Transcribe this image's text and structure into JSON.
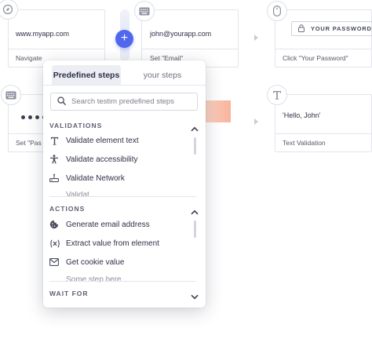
{
  "steps": {
    "row1": [
      {
        "value": "www.myapp.com",
        "label": "Navigate",
        "icon": "compass-icon"
      },
      {
        "value": "john@yourapp.com",
        "label": "Set \"Email\"",
        "icon": "keyboard-icon"
      },
      {
        "value": "YOUR PASSWORD",
        "label": "Click \"Your Password\"",
        "icon": "mouse-icon"
      }
    ],
    "row2": [
      {
        "label": "Set \"Pas",
        "icon": "keyboard-icon"
      },
      {
        "value": "'Hello, John'",
        "label": "Text Validation",
        "icon": "text-icon"
      }
    ]
  },
  "add_button": "+",
  "popup": {
    "tabs": [
      {
        "label": "Predefined steps",
        "active": true
      },
      {
        "label": "your steps",
        "active": false
      }
    ],
    "search_placeholder": "Search testim predefined steps",
    "sections": [
      {
        "title": "VALIDATIONS",
        "expanded": true,
        "items": [
          {
            "label": "Validate element text",
            "icon": "text-icon"
          },
          {
            "label": "Validate accessibility",
            "icon": "accessibility-icon"
          },
          {
            "label": "Validate Network",
            "icon": "network-icon"
          },
          {
            "label": "Validat...",
            "icon": "",
            "partial": true
          }
        ]
      },
      {
        "title": "ACTIONS",
        "expanded": true,
        "items": [
          {
            "label": "Generate email address",
            "icon": "cookie-icon"
          },
          {
            "label": "Extract value from element",
            "icon": "variable-icon"
          },
          {
            "label": "Get cookie value",
            "icon": "envelope-icon"
          },
          {
            "label": "Some step here",
            "icon": "",
            "partial": true
          }
        ]
      },
      {
        "title": "WAIT FOR",
        "expanded": false,
        "items": []
      }
    ]
  },
  "colors": {
    "accent": "#4f68ee",
    "text": "#2d3047",
    "muted": "#7d8090",
    "border": "#e3e5ec",
    "highlight": "#f7b29c"
  }
}
